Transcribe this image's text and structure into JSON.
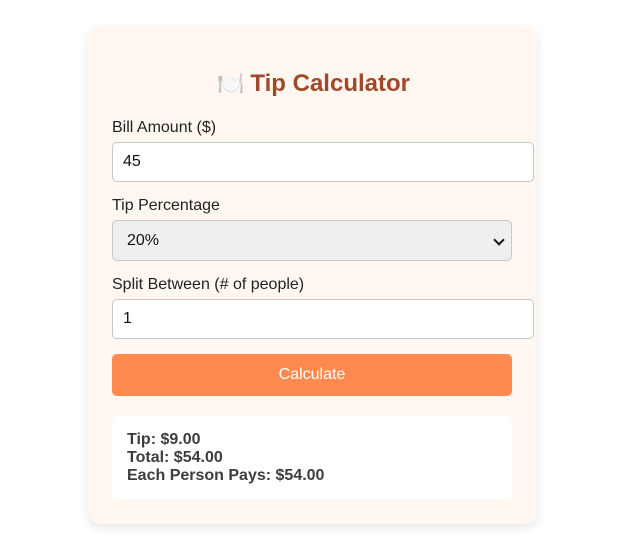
{
  "app": {
    "title_icon": "🍽️",
    "title": "Tip Calculator"
  },
  "form": {
    "bill_label": "Bill Amount ($)",
    "bill_value": "45",
    "tip_label": "Tip Percentage",
    "tip_selected": "20%",
    "split_label": "Split Between (# of people)",
    "split_value": "1",
    "calculate_label": "Calculate"
  },
  "result": {
    "tip": "Tip: $9.00",
    "total": "Total: $54.00",
    "each": "Each Person Pays: $54.00"
  },
  "colors": {
    "card_bg": "#fff7f0",
    "title": "#a0492a",
    "button": "#ff8a4f"
  }
}
